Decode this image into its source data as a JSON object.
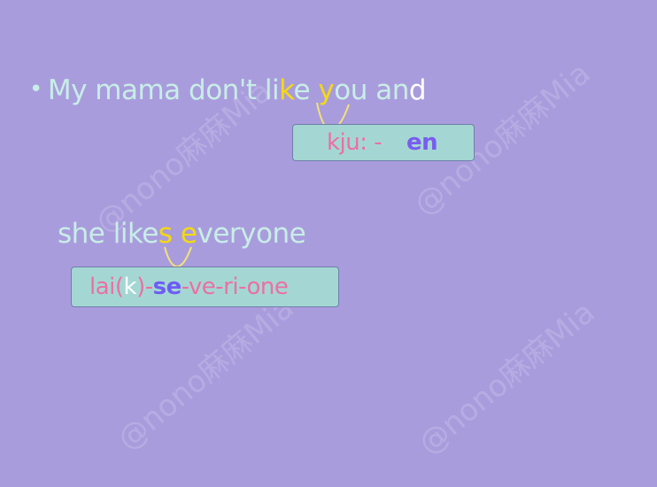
{
  "line1": {
    "bullet": "•",
    "seg1": "My mama don't li",
    "seg2": "k",
    "seg3": "e ",
    "seg4": "y",
    "seg5": "ou an",
    "seg6": "d"
  },
  "box1": {
    "part1": "kju: -",
    "part2": "en"
  },
  "line2": {
    "seg1": "she like",
    "seg2": "s",
    "seg3": " ",
    "seg4": "e",
    "seg5": "veryone"
  },
  "box2": {
    "p1": "lai(",
    "p2": "k",
    "p3": ")-",
    "p4": "se",
    "p5": "-ve-ri-one"
  },
  "watermark": "@nono麻麻Mia",
  "colors": {
    "background": "#a99cdd",
    "text": "#c8eee6",
    "highlight": "#f5d90f",
    "box_fill": "#a4d7d3",
    "pink": "#ec6fa4",
    "blue": "#6e5cf5"
  }
}
